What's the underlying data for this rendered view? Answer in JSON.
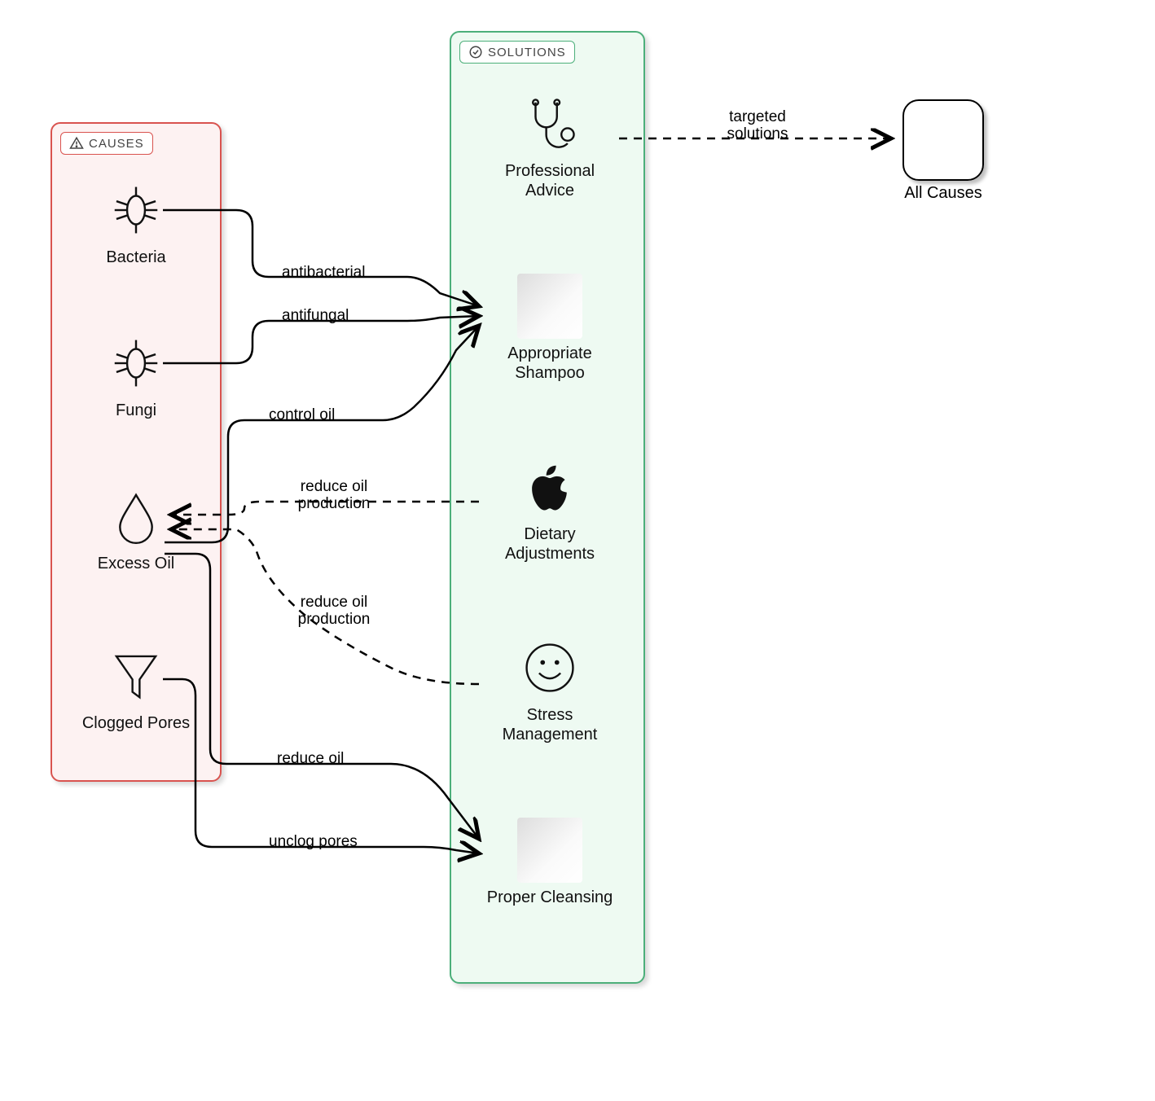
{
  "causes": {
    "title": "CAUSES",
    "items": [
      {
        "id": "bacteria",
        "label": "Bacteria"
      },
      {
        "id": "fungi",
        "label": "Fungi"
      },
      {
        "id": "excess-oil",
        "label": "Excess Oil"
      },
      {
        "id": "clogged-pores",
        "label": "Clogged Pores"
      }
    ]
  },
  "solutions": {
    "title": "SOLUTIONS",
    "items": [
      {
        "id": "professional-advice",
        "label": "Professional Advice"
      },
      {
        "id": "appropriate-shampoo",
        "label": "Appropriate Shampoo"
      },
      {
        "id": "dietary-adjustments",
        "label": "Dietary Adjustments"
      },
      {
        "id": "stress-management",
        "label": "Stress Management"
      },
      {
        "id": "proper-cleansing",
        "label": "Proper Cleansing"
      }
    ]
  },
  "allcauses": {
    "label": "All Causes"
  },
  "edges": {
    "bacteria_shampoo": "antibacterial",
    "fungi_shampoo": "antifungal",
    "oil_shampoo": "control oil",
    "diet_oil": "reduce oil production",
    "stress_oil": "reduce oil production",
    "oil_cleansing": "reduce oil",
    "pores_cleansing": "unclog pores",
    "advice_all": "targeted solutions"
  }
}
